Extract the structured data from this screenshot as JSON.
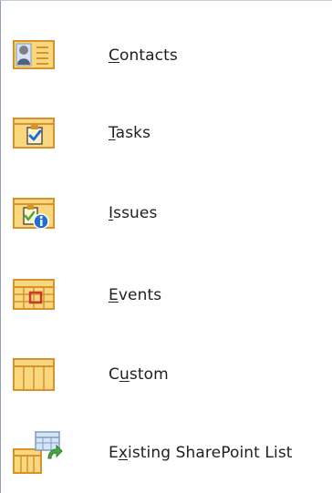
{
  "menu": {
    "items": [
      {
        "id": "contacts",
        "label": "Contacts",
        "mnemonic_index": 0,
        "icon": "contacts-icon"
      },
      {
        "id": "tasks",
        "label": "Tasks",
        "mnemonic_index": 0,
        "icon": "tasks-icon"
      },
      {
        "id": "issues",
        "label": "Issues",
        "mnemonic_index": 0,
        "icon": "issues-icon"
      },
      {
        "id": "events",
        "label": "Events",
        "mnemonic_index": 0,
        "icon": "events-icon"
      },
      {
        "id": "custom",
        "label": "Custom",
        "mnemonic_index": 1,
        "icon": "custom-table-icon"
      },
      {
        "id": "existing_sharepoint",
        "label": "Existing SharePoint List",
        "mnemonic_index": 1,
        "icon": "existing-sharepoint-list-icon"
      }
    ]
  },
  "colors": {
    "icon_fill": "#f8d77e",
    "icon_border": "#d7922b",
    "icon_light": "#fff4cc",
    "accent_blue": "#1f6fd1",
    "accent_green": "#4aa63f",
    "accent_red": "#c73a32"
  }
}
